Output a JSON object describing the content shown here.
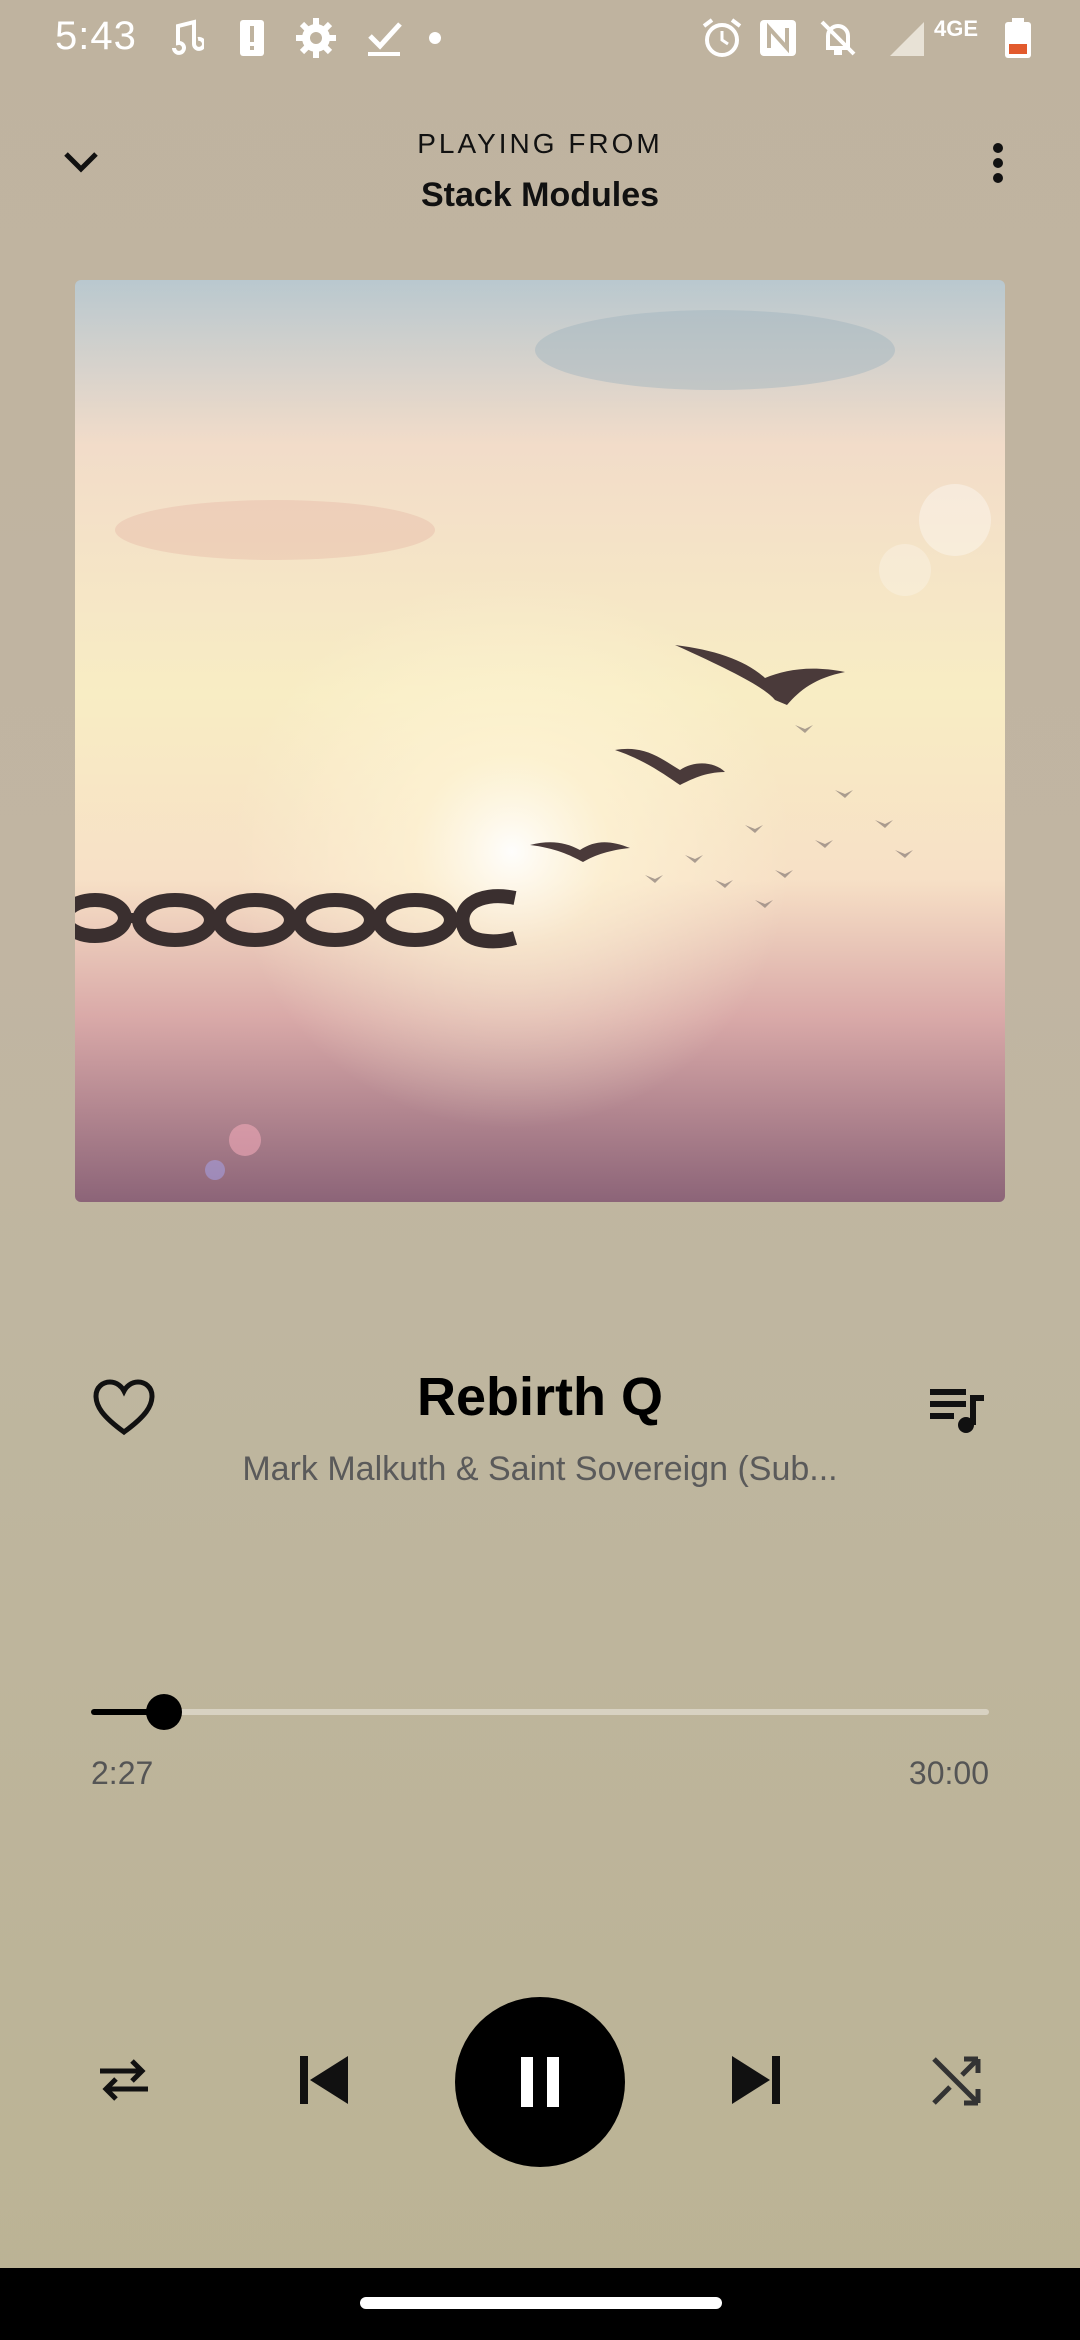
{
  "status_bar": {
    "time": "5:43",
    "left_icons": [
      "music-note-icon",
      "alert-icon",
      "settings-icon",
      "download-done-icon",
      "dot-icon"
    ],
    "right_icons": [
      "alarm-icon",
      "nfc-icon",
      "mute-icon",
      "signal-icon",
      "4g-icon",
      "battery-icon"
    ],
    "network_label": "4GE"
  },
  "header": {
    "playing_from_label": "PLAYING FROM",
    "context_name": "Stack Modules",
    "collapse_icon": "chevron-down-icon",
    "menu_icon": "more-vertical-icon"
  },
  "track": {
    "title": "Rebirth Q",
    "artist": "Mark Malkuth & Saint Sovereign (Sub..."
  },
  "progress": {
    "elapsed": "2:27",
    "total": "30:00",
    "fraction": 0.0817
  },
  "controls": {
    "favorite_icon": "heart-outline-icon",
    "queue_icon": "queue-music-icon",
    "repeat_icon": "repeat-icon",
    "previous_icon": "skip-previous-icon",
    "play_pause_icon": "pause-icon",
    "next_icon": "skip-next-icon",
    "shuffle_icon": "shuffle-icon"
  },
  "colors": {
    "background": "#bfb39f",
    "accent": "#000000",
    "secondary_text": "#5a5a5a"
  }
}
